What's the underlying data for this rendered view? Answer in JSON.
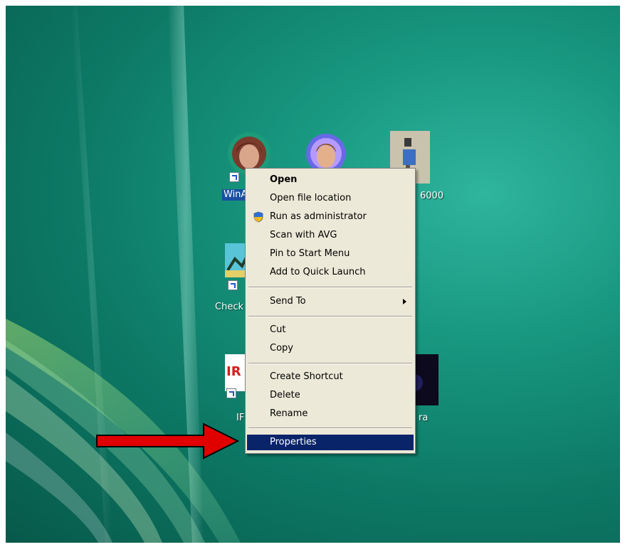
{
  "desktop": {
    "icons": [
      {
        "name": "WinA",
        "label": "WinA",
        "selected": true
      },
      {
        "name": "profile",
        "label": ""
      },
      {
        "name": "6000",
        "label": "6000"
      },
      {
        "name": "Check",
        "label": "Check"
      },
      {
        "name": "IR",
        "label": "IF"
      },
      {
        "name": "ra",
        "label": "ra"
      }
    ],
    "colors": {
      "wallpaper": "#18977f",
      "selection": "#1a4fa3"
    }
  },
  "context_menu": {
    "items": [
      {
        "label": "Open",
        "bold": true
      },
      {
        "label": "Open file location"
      },
      {
        "label": "Run as administrator",
        "icon": "uac-shield-icon"
      },
      {
        "label": "Scan with AVG"
      },
      {
        "label": "Pin to Start Menu"
      },
      {
        "label": "Add to Quick Launch"
      },
      {
        "label": "Send To",
        "submenu": true
      },
      {
        "label": "Cut"
      },
      {
        "label": "Copy"
      },
      {
        "label": "Create Shortcut"
      },
      {
        "label": "Delete"
      },
      {
        "label": "Rename"
      },
      {
        "label": "Properties",
        "highlighted": true
      }
    ],
    "colors": {
      "background": "#ece9d8",
      "highlight": "#0a246a",
      "highlight_text": "#ffffff"
    }
  },
  "annotation": {
    "arrow_color": "#e00000",
    "arrow_icon": "red-arrow-icon"
  }
}
